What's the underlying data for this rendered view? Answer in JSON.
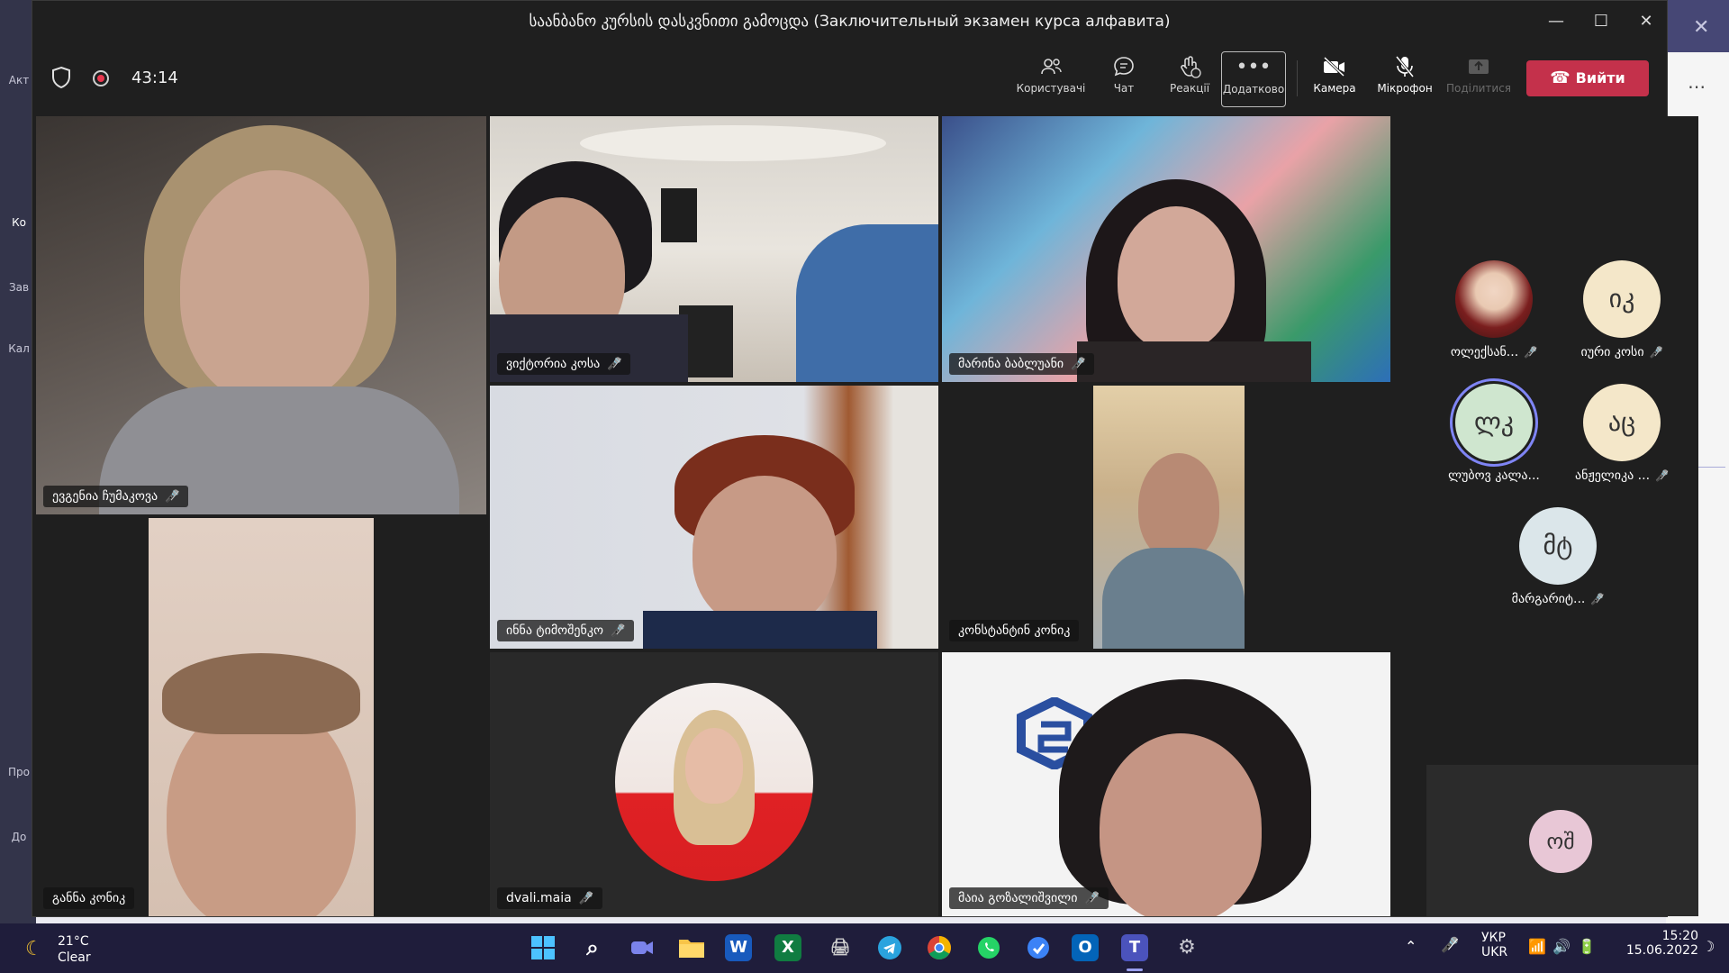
{
  "window": {
    "title": "საანბანო კურსის დასკვნითი გამოცდა (Заключительный экзамен курса алфавита)",
    "minimize": "—",
    "maximize": "☐",
    "close": "✕"
  },
  "meeting": {
    "timer": "43:14",
    "toolbar": {
      "people": "Користувачі",
      "chat": "Чат",
      "reactions": "Реакції",
      "more": "Додатково",
      "camera": "Камера",
      "mic": "Мікрофон",
      "share": "Поділитися",
      "leave": "Вийти"
    }
  },
  "tiles": [
    {
      "name": "ევგენია ჩუმაკოვა"
    },
    {
      "name": "ვიქტორია კოსა"
    },
    {
      "name": "მარინა ბაბლუანი"
    },
    {
      "name": "განნა კონიკ"
    },
    {
      "name": "ინნა ტიმოშენკო"
    },
    {
      "name": "კონსტანტინ კონიკ"
    },
    {
      "name": "dvali.maia"
    },
    {
      "name": "მაია გოზალიშვილი"
    }
  ],
  "gallery": [
    {
      "name": "ოლექსან...",
      "initials": ""
    },
    {
      "name": "იური კოსი",
      "initials": "იკ"
    },
    {
      "name": "ლუბოვ კალა...",
      "initials": "ლკ"
    },
    {
      "name": "ანჟელიკა ...",
      "initials": "აც"
    },
    {
      "name": "მარგარიტ...",
      "initials": "მტ"
    }
  ],
  "self_view": {
    "initials": "ოშ"
  },
  "background_app": {
    "rail": [
      "Акт",
      "Ко",
      "Зав",
      "Кал",
      "Про",
      "До"
    ]
  },
  "taskbar": {
    "temperature": "21°C",
    "weather": "Clear",
    "lang1": "УКР",
    "lang2": "UKR",
    "time": "15:20",
    "date": "15.06.2022"
  },
  "colors": {
    "leave": "#c4314b",
    "teams_accent": "#5b5fc7",
    "window_bg": "#1f1f1f"
  }
}
